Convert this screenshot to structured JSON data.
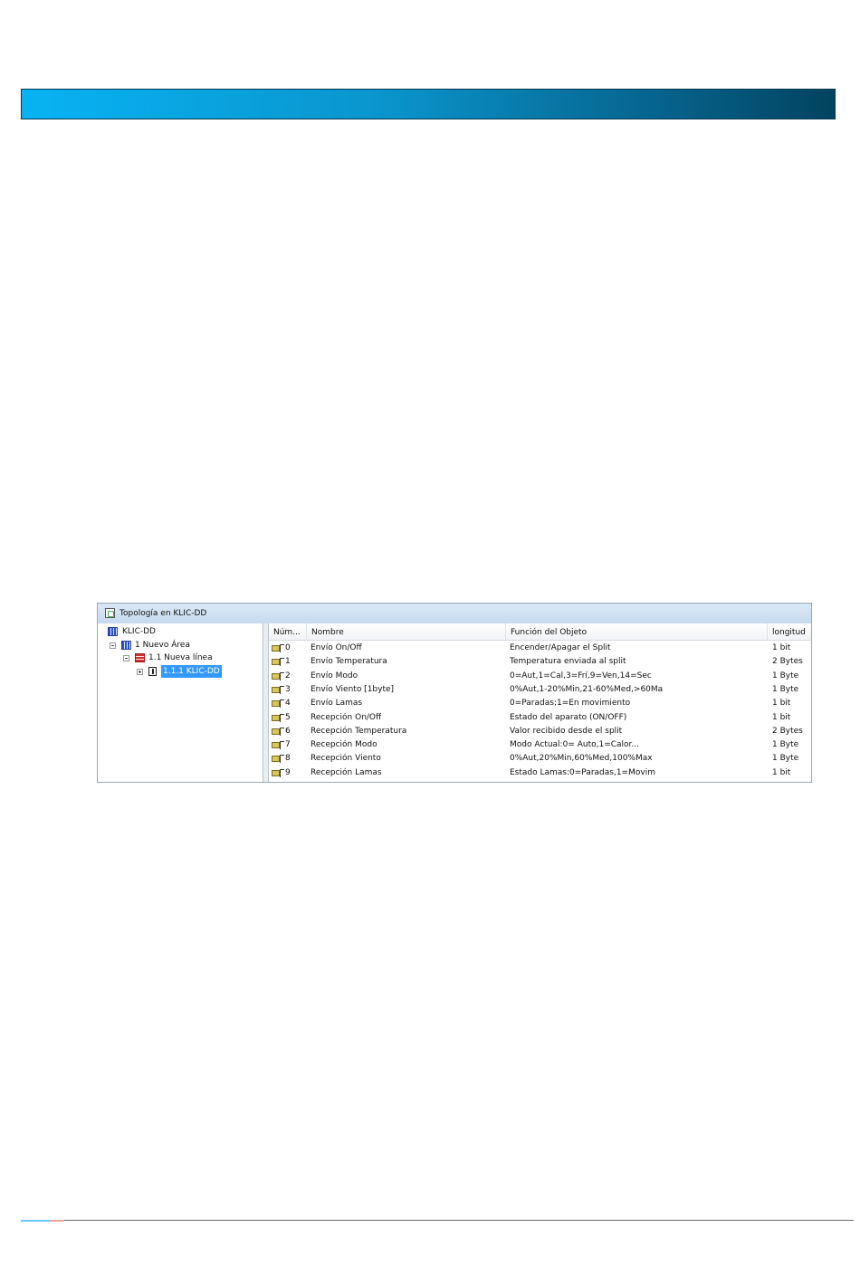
{
  "window": {
    "title": "Topología en KLIC-DD"
  },
  "tree": {
    "project": "KLIC-DD",
    "area": "1 Nuevo Área",
    "line": "1.1 Nueva línea",
    "device": "1.1.1 KLIC-DD"
  },
  "table": {
    "headers": [
      "Núm...",
      "Nombre",
      "Función del Objeto",
      "longitud"
    ],
    "rows": [
      {
        "num": "0",
        "name": "Envío On/Off",
        "func": "Encender/Apagar el Split",
        "len": "1 bit"
      },
      {
        "num": "1",
        "name": "Envío Temperatura",
        "func": "Temperatura enviada al split",
        "len": "2 Bytes"
      },
      {
        "num": "2",
        "name": "Envío Modo",
        "func": "0=Aut,1=Cal,3=Frí,9=Ven,14=Sec",
        "len": "1 Byte"
      },
      {
        "num": "3",
        "name": "Envío Viento [1byte]",
        "func": "0%Aut,1-20%Min,21-60%Med,>60Ma",
        "len": "1 Byte"
      },
      {
        "num": "4",
        "name": "Envío Lamas",
        "func": "0=Paradas;1=En movimiento",
        "len": "1 bit"
      },
      {
        "num": "5",
        "name": "Recepción On/Off",
        "func": "Estado del aparato (ON/OFF)",
        "len": "1 bit"
      },
      {
        "num": "6",
        "name": "Recepción Temperatura",
        "func": "Valor recibido desde el split",
        "len": "2 Bytes"
      },
      {
        "num": "7",
        "name": "Recepción Modo",
        "func": "Modo Actual:0= Auto,1=Calor...",
        "len": "1 Byte"
      },
      {
        "num": "8",
        "name": "Recepción Viento",
        "func": "0%Aut,20%Min,60%Med,100%Max",
        "len": "1 Byte"
      },
      {
        "num": "9",
        "name": "Recepción Lamas",
        "func": "Estado Lamas:0=Paradas,1=Movim",
        "len": "1 bit"
      }
    ]
  },
  "colors": {
    "header_band_start": "#08b3f3",
    "header_band_end": "#02435f",
    "selection": "#3399ff"
  }
}
